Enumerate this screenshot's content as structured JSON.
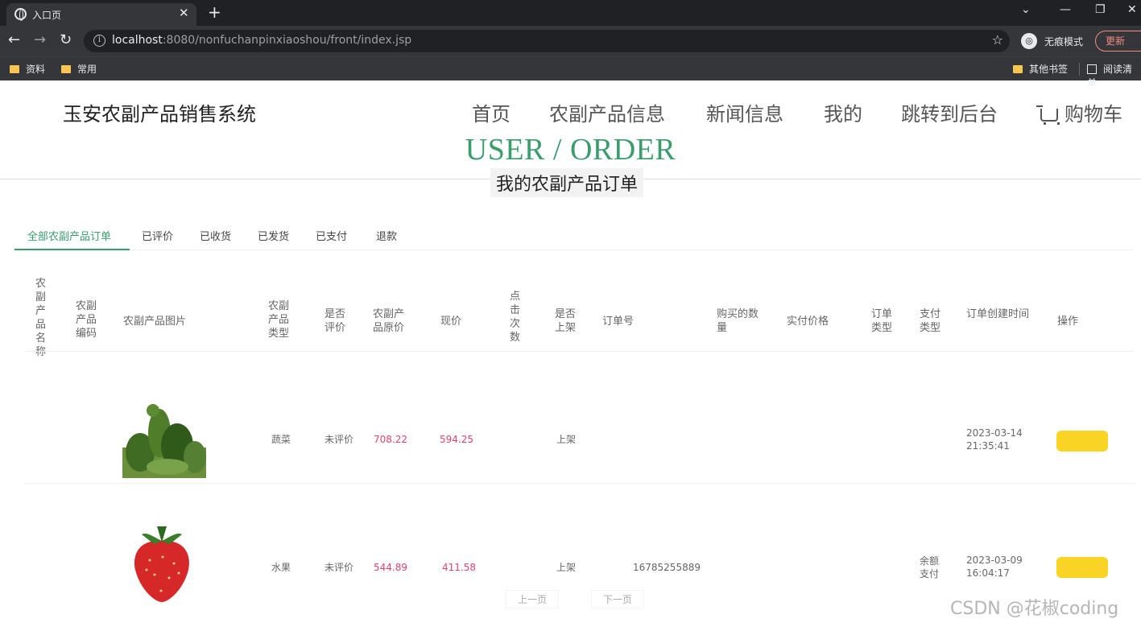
{
  "browser": {
    "tab_title": "入口页",
    "url_host": "localhost",
    "url_rest": ":8080/nonfuchanpinxiaoshou/front/index.jsp",
    "incognito_label": "无痕模式",
    "update_label": "更新",
    "bookmarks": [
      "资料",
      "常用",
      "其他书签",
      "阅读清单"
    ]
  },
  "site": {
    "title": "玉安农副产品销售系统",
    "nav": [
      "首页",
      "农副产品信息",
      "新闻信息",
      "我的",
      "跳转到后台",
      "购物车"
    ],
    "page_title_en": "USER / ORDER",
    "page_title_cn": "我的农副产品订单"
  },
  "order_tabs": [
    "全部农副产品订单",
    "已评价",
    "已收货",
    "已发货",
    "已支付",
    "退款"
  ],
  "table": {
    "headers": [
      "农副产品名称",
      "农副产品编码",
      "农副产品图片",
      "农副产品类型",
      "是否评价",
      "农副产品原价",
      "现价",
      "点击次数",
      "是否上架",
      "订单号",
      "购买的数量",
      "实付价格",
      "订单类型",
      "支付类型",
      "订单创建时间",
      "操作"
    ],
    "rows": [
      {
        "image": "vegetables",
        "type": "蔬菜",
        "review": "未评价",
        "orig_price": "708.22",
        "price": "594.25",
        "status": "上架",
        "time": "2023-03-14 21:35:41"
      },
      {
        "image": "strawberry",
        "type": "水果",
        "review": "未评价",
        "orig_price": "544.89",
        "price": "411.58",
        "status": "上架",
        "order_no": "16785255889",
        "pay_type": "余额支付",
        "time": "2023-03-09 16:04:17"
      }
    ]
  },
  "pager": [
    "上一页",
    "下一页"
  ],
  "watermark": "CSDN @花椒coding",
  "colors": {
    "accent": "#3a9d6e",
    "price": "#e0436a",
    "button": "#f9d423"
  }
}
